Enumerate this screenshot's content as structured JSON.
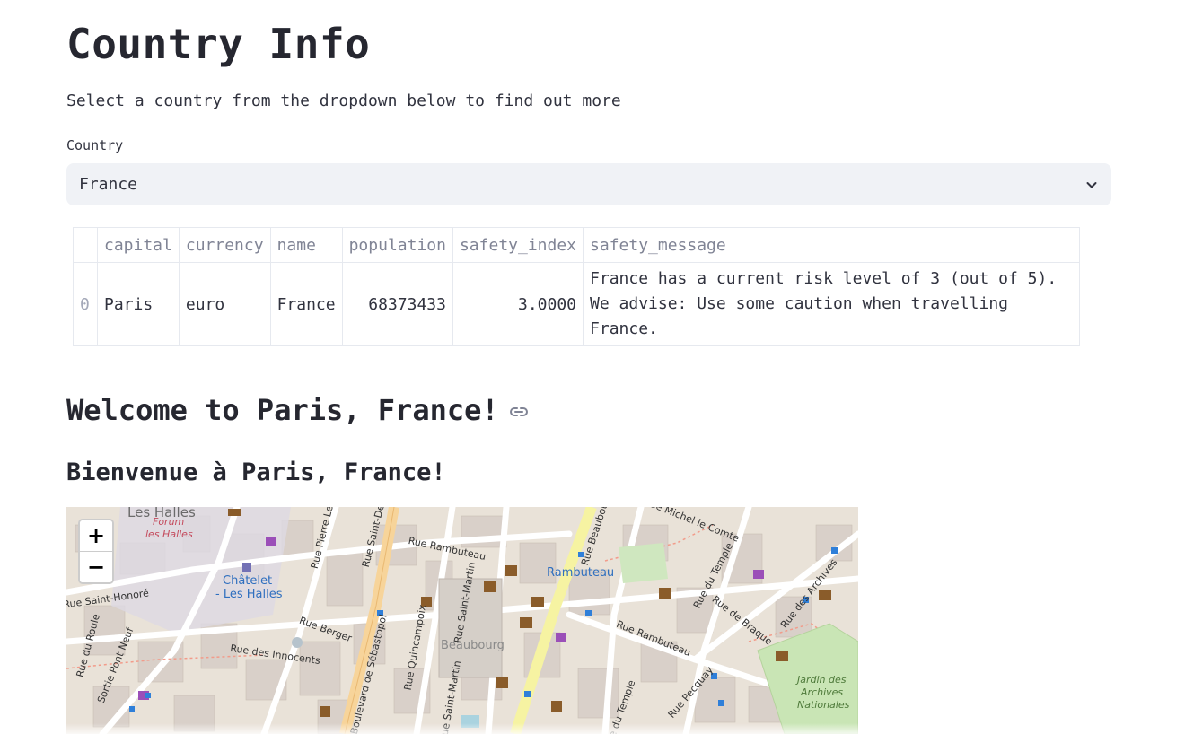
{
  "page": {
    "title": "Country Info",
    "subtitle": "Select a country from the dropdown below to find out more"
  },
  "country_select": {
    "label": "Country",
    "value": "France",
    "chevron_icon": "chevron-down-icon"
  },
  "table": {
    "columns": [
      "",
      "capital",
      "currency",
      "name",
      "population",
      "safety_index",
      "safety_message"
    ],
    "rows": [
      {
        "index": "0",
        "capital": "Paris",
        "currency": "euro",
        "name": "France",
        "population": "68373433",
        "safety_index": "3.0000",
        "safety_message": "France has a current risk level of 3 (out of 5). We advise: Use some caution when travelling France."
      }
    ]
  },
  "welcome_heading": "Welcome to Paris, France!",
  "anchor_icon": "link-icon",
  "bienvenue_heading": "Bienvenue à Paris, France!",
  "map": {
    "zoom_in": "+",
    "zoom_out": "−",
    "labels": {
      "les_halles": "Les Halles",
      "forum": "Forum",
      "forum_sub": "les Halles",
      "chatelet": "Châtelet",
      "chatelet_sub": "- Les Halles",
      "rambuteau_station": "Rambuteau",
      "beaubourg": "Beaubourg",
      "jardin": "Jardin des",
      "jardin2": "Archives",
      "jardin3": "Nationales",
      "rue_rambuteau": "Rue Rambuteau",
      "rue_rambuteau2": "Rue Rambuteau",
      "rue_berger": "Rue Berger",
      "rue_innocents": "Rue des Innocents",
      "bd_sebastopol": "Boulevard de Sébastopol",
      "rue_quincampoix": "Rue Quincampoix",
      "rue_st_martin": "Rue Saint-Martin",
      "rue_st_martin2": "Rue Saint-Martin",
      "rue_st_honore": "Rue Saint-Honoré",
      "rue_du_roule": "Rue du Roule",
      "rue_pont_neuf": "Sortie Pont Neuf",
      "rue_du_temple": "Rue du Temple",
      "rue_du_temple2": "Rue du Temple",
      "rue_de_braque": "Rue de Braque",
      "rue_pecquay": "Rue Pecquay",
      "rue_archives": "Rue des Archives",
      "rue_michel_comte": "Rue Michel le Comte",
      "rue_pierre": "Rue Pierre Lescot",
      "rue_st_denis": "Rue Saint-Denis",
      "rue_beaubourg": "Rue Beaubourg"
    }
  }
}
